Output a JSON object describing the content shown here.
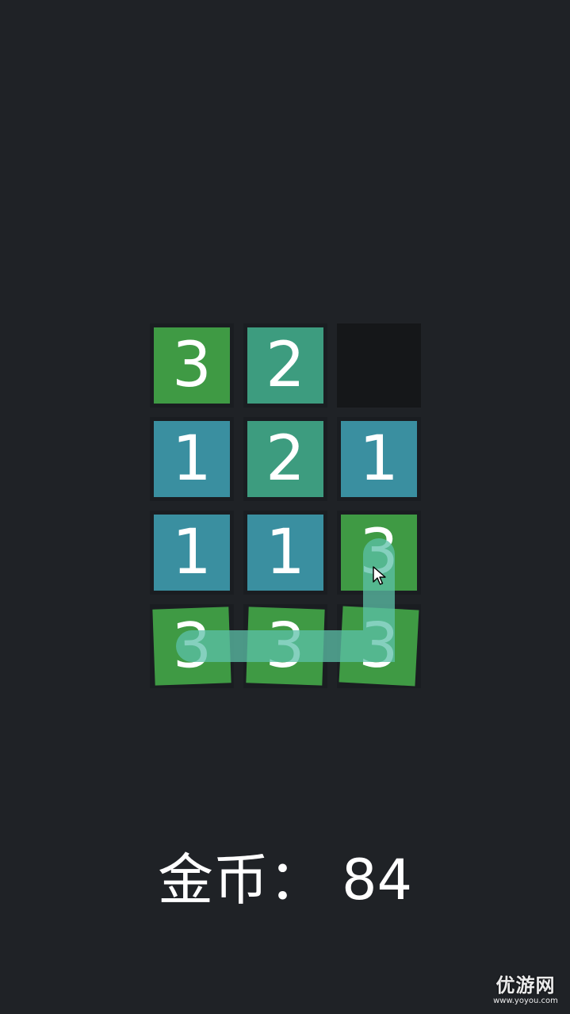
{
  "colors": {
    "background": "#1f2226",
    "tile_value_1": "#3a8fa0",
    "tile_value_2": "#3d9c7f",
    "tile_value_3": "#3f9a44",
    "empty_cell": "#151719",
    "selection_path": "#5cc0a8"
  },
  "board": {
    "rows": 4,
    "cols": 3,
    "cells": [
      {
        "value": "3",
        "state": "filled"
      },
      {
        "value": "2",
        "state": "filled"
      },
      {
        "value": "",
        "state": "empty"
      },
      {
        "value": "1",
        "state": "filled"
      },
      {
        "value": "2",
        "state": "filled"
      },
      {
        "value": "1",
        "state": "filled"
      },
      {
        "value": "1",
        "state": "filled"
      },
      {
        "value": "1",
        "state": "filled"
      },
      {
        "value": "3",
        "state": "selected"
      },
      {
        "value": "3",
        "state": "selected"
      },
      {
        "value": "3",
        "state": "selected"
      },
      {
        "value": "3",
        "state": "selected"
      }
    ],
    "selection_path": [
      [
        2,
        2
      ],
      [
        3,
        2
      ],
      [
        3,
        1
      ],
      [
        3,
        0
      ]
    ]
  },
  "footer": {
    "coins_label": "金币：",
    "coins_value": "84"
  },
  "watermark": {
    "text": "优游网",
    "subtext": "www.yoyou.com"
  }
}
